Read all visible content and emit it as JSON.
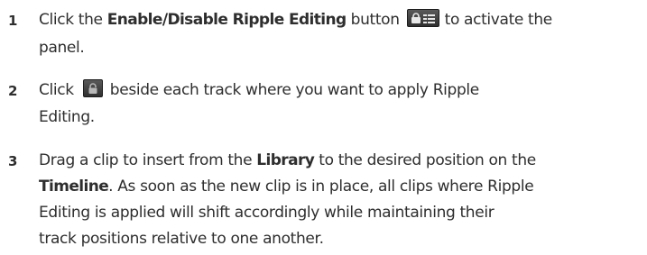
{
  "steps": [
    {
      "number": "1",
      "line1": {
        "pre": "Click the ",
        "bold": "Enable/Disable Ripple Editing",
        "mid": " button",
        "post": "to activate the"
      },
      "line2": "panel.",
      "icon": "ripple-editing-panel-icon"
    },
    {
      "number": "2",
      "line1": {
        "pre": "Click",
        "post": "beside each track where you want to apply Ripple"
      },
      "line2": "Editing.",
      "icon": "track-ripple-lock-icon"
    },
    {
      "number": "3",
      "line1": {
        "pre": "Drag a clip to insert from the ",
        "bold": "Library",
        "post": " to the desired position on the"
      },
      "line2": {
        "bold": "Timeline",
        "post": ". As soon as the new clip is in place, all clips where Ripple"
      },
      "line3": "Editing is applied will shift accordingly while maintaining their",
      "line4": "track positions relative to one another."
    }
  ]
}
